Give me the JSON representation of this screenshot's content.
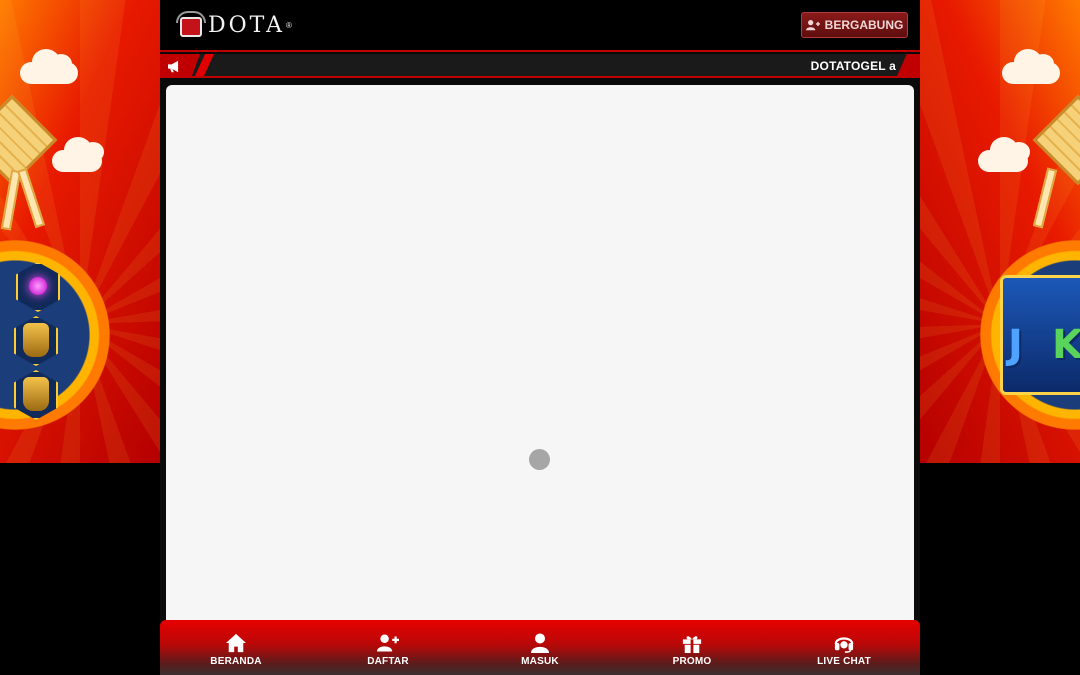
{
  "header": {
    "logo_text": "DOTA",
    "logo_mark": "®",
    "join_label": "BERGABUNG",
    "join_icon": "user-plus-icon"
  },
  "ticker": {
    "icon": "megaphone-icon",
    "text": "DOTATOGEL a"
  },
  "content": {
    "loading_indicator": "spinner"
  },
  "bottom_nav": {
    "items": [
      {
        "label": "BERANDA",
        "icon": "home-icon"
      },
      {
        "label": "DAFTAR",
        "icon": "user-plus-icon"
      },
      {
        "label": "MASUK",
        "icon": "user-icon"
      },
      {
        "label": "PROMO",
        "icon": "gift-icon"
      },
      {
        "label": "LIVE CHAT",
        "icon": "headset-icon"
      }
    ]
  },
  "colors": {
    "accent": "#c00000",
    "nav_top": "#e60000",
    "content_bg": "#f6f6f6",
    "loader": "#a6a6a6"
  }
}
